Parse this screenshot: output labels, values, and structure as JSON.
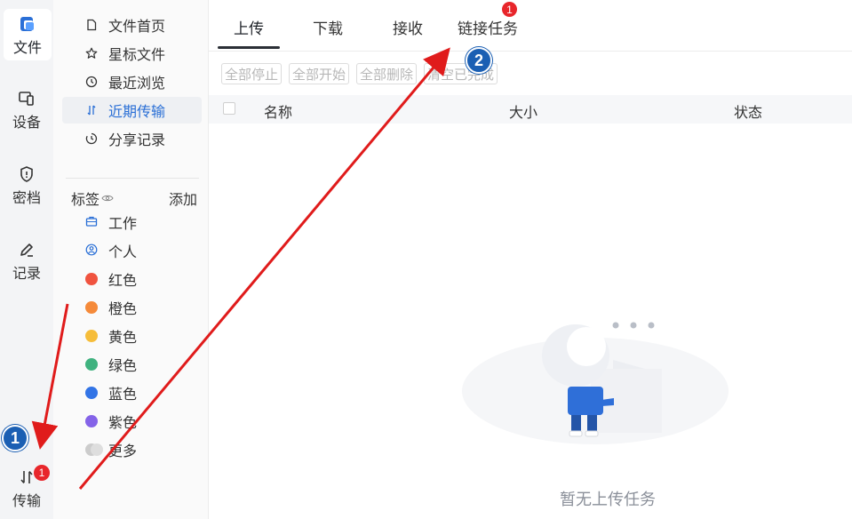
{
  "rail": {
    "items": [
      {
        "label": "文件",
        "icon": "file-app-icon"
      },
      {
        "label": "设备",
        "icon": "devices-icon"
      },
      {
        "label": "密档",
        "icon": "shield-icon"
      },
      {
        "label": "记录",
        "icon": "pencil-icon"
      },
      {
        "label": "传输",
        "icon": "transfer-icon",
        "badge": "1"
      }
    ]
  },
  "sidebar": {
    "nav": [
      {
        "label": "文件首页",
        "icon": "document-icon"
      },
      {
        "label": "星标文件",
        "icon": "star-icon"
      },
      {
        "label": "最近浏览",
        "icon": "clock-icon"
      },
      {
        "label": "近期传输",
        "icon": "transfer-icon",
        "active": true
      },
      {
        "label": "分享记录",
        "icon": "share-history-icon"
      }
    ],
    "tags_title": "标签",
    "tags_add": "添加",
    "tags": [
      {
        "label": "工作",
        "icon": "briefcase-icon",
        "color": "#2a6fd6"
      },
      {
        "label": "个人",
        "icon": "person-icon",
        "color": "#2a6fd6"
      },
      {
        "label": "红色",
        "color": "#f0533f"
      },
      {
        "label": "橙色",
        "color": "#f58a3a"
      },
      {
        "label": "黄色",
        "color": "#f6bd3a"
      },
      {
        "label": "绿色",
        "color": "#3fb27f"
      },
      {
        "label": "蓝色",
        "color": "#3274e6"
      },
      {
        "label": "紫色",
        "color": "#8463e8"
      },
      {
        "label": "更多",
        "color": "#cccccc"
      }
    ]
  },
  "main": {
    "tabs": [
      {
        "label": "上传",
        "active": true
      },
      {
        "label": "下载"
      },
      {
        "label": "接收"
      },
      {
        "label": "链接任务",
        "badge": "1"
      }
    ],
    "toolbar": [
      "全部停止",
      "全部开始",
      "全部删除",
      "清空已完成"
    ],
    "columns": [
      "名称",
      "大小",
      "状态"
    ],
    "empty_text": "暂无上传任务"
  },
  "annotations": {
    "marker1": "1",
    "marker2": "2",
    "arrow_color": "#e01b1b",
    "marker_color": "#1b5fb3"
  }
}
